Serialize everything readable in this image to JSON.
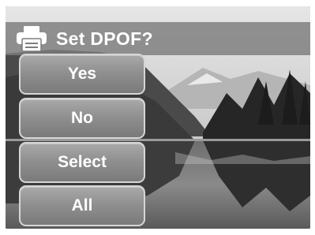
{
  "dialog": {
    "title": "Set DPOF?",
    "icon": "printer-icon"
  },
  "menu": {
    "items": [
      {
        "label": "Yes"
      },
      {
        "label": "No"
      },
      {
        "label": "Select"
      },
      {
        "label": "All"
      }
    ]
  },
  "colors": {
    "title_bar": "#7d7d7d",
    "button_fill": "#909090",
    "button_border": "#d6d6d6",
    "text": "#ffffff"
  }
}
